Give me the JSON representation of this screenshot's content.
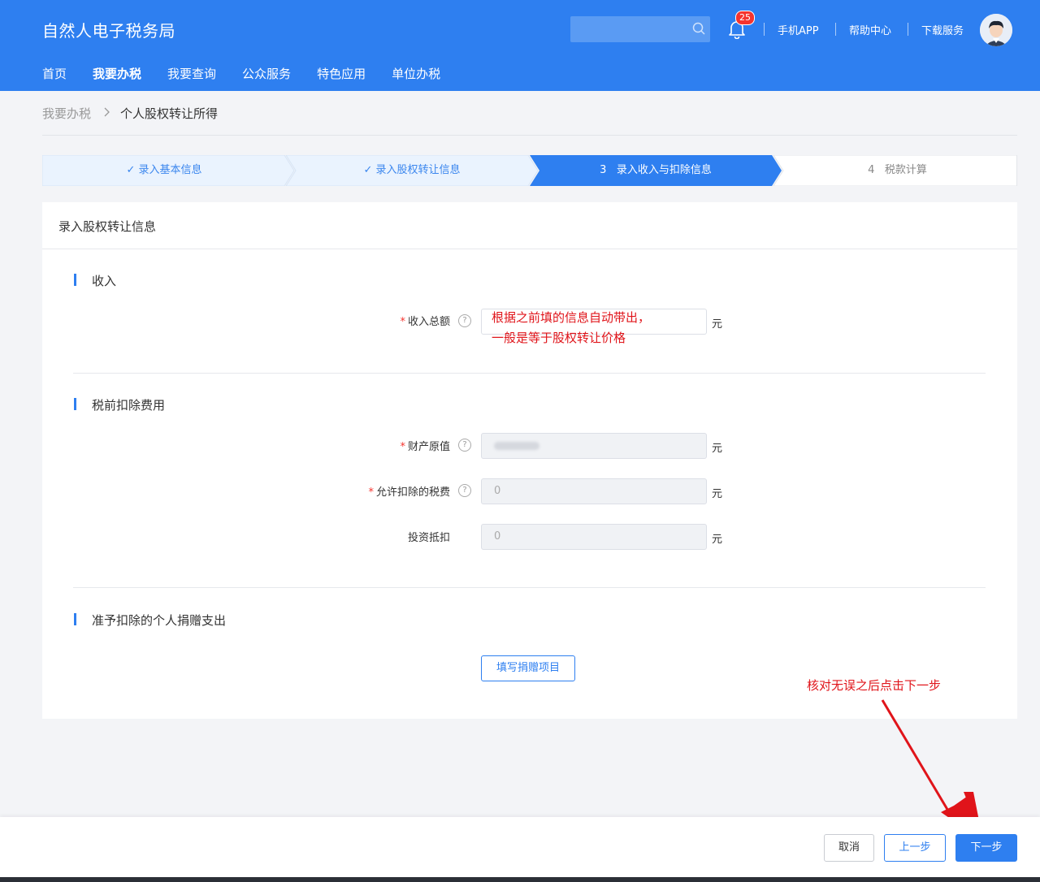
{
  "header": {
    "brand": "自然人电子税务局",
    "search": {
      "placeholder": "",
      "value": ""
    },
    "notification_count": "25",
    "links": [
      "手机APP",
      "帮助中心",
      "下载服务"
    ],
    "nav": [
      "首页",
      "我要办税",
      "我要查询",
      "公众服务",
      "特色应用",
      "单位办税"
    ],
    "nav_active": "我要办税",
    "colors": {
      "primary": "#2e7ff0",
      "badge": "#f5342f"
    }
  },
  "breadcrumb": {
    "parent": "我要办税",
    "separator": ">",
    "current": "个人股权转让所得"
  },
  "steps": [
    {
      "label": "录入基本信息",
      "state": "done"
    },
    {
      "label": "录入股权转让信息",
      "state": "done"
    },
    {
      "number": "3",
      "label": "录入收入与扣除信息",
      "state": "active"
    },
    {
      "number": "4",
      "label": "税款计算",
      "state": "pending"
    }
  ],
  "card": {
    "title": "录入股权转让信息",
    "sections": {
      "income": {
        "title": "收入",
        "fields": [
          {
            "label": "收入总额",
            "required": true,
            "help": "?",
            "value": "",
            "unit": "元"
          }
        ]
      },
      "deduction": {
        "title": "税前扣除费用",
        "fields": [
          {
            "label": "财产原值",
            "required": true,
            "help": "?",
            "value": "",
            "blurred": true,
            "unit": "元"
          },
          {
            "label": "允许扣除的税费",
            "required": true,
            "help": "?",
            "value": "0",
            "unit": "元"
          },
          {
            "label": "投资抵扣",
            "required": false,
            "value": "0",
            "unit": "元"
          }
        ]
      },
      "donation": {
        "title": "准予扣除的个人捐赠支出",
        "button": "填写捐赠项目"
      }
    }
  },
  "annotations": {
    "income_note_line1": "根据之前填的信息自动带出，",
    "income_note_line2": "一般是等于股权转让价格",
    "next_note": "核对无误之后点击下一步",
    "color": "#e0141a"
  },
  "footer": {
    "cancel": "取消",
    "prev": "上一步",
    "next": "下一步"
  }
}
